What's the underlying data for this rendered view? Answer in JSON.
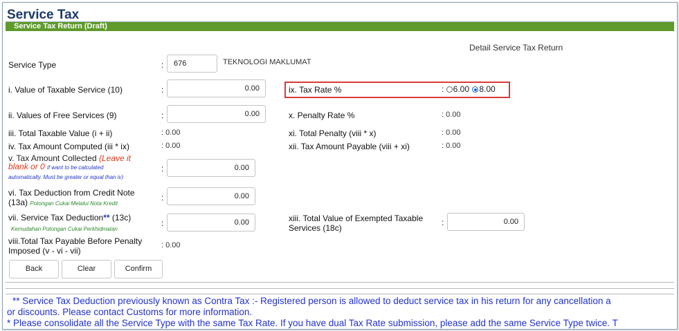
{
  "header": {
    "title": "Service Tax",
    "section": "Service Tax Return (Draft)",
    "detail_label": "Detail Service Tax Return"
  },
  "form": {
    "service_type": {
      "label": "Service Type",
      "code": "676",
      "name": "TEKNOLOGI MAKLUMAT"
    },
    "taxable_service": {
      "label": "i. Value of Taxable Service (10)",
      "value": "0.00"
    },
    "free_services": {
      "label": "ii. Values of Free Services (9)",
      "value": "0.00"
    },
    "total_taxable": {
      "label": "iii. Total Taxable Value (i + ii)",
      "value": ": 0.00"
    },
    "tax_computed": {
      "label": "iv. Tax Amount Computed (iii * ix)",
      "value": ": 0.00"
    },
    "tax_collected": {
      "label": "v. Tax Amount Collected",
      "hint_red_1": "(Leave it",
      "hint_red_2": "blank or 0",
      "hint_blue_1": "if want to be calculated",
      "hint_blue_2": "automatically. Must be greater or equal than iv)",
      "value": "0.00"
    },
    "credit_note": {
      "label_1": "vi. Tax Deduction from Credit Note",
      "label_2": "(13a)",
      "sub": "Potongan Cukai Melalui Nota Kredit",
      "value": "0.00"
    },
    "service_deduction": {
      "label": "vii. Service Tax Deduction",
      "stars": "**",
      "suffix": "(13c)",
      "sub": "Kemudahan Potongan Cukai Perkhidmatan",
      "value": "0.00"
    },
    "total_before_penalty": {
      "label_1": "viii.Total Tax Payable Before Penalty",
      "label_2": "Imposed (v - vi - vii)",
      "value": ": 0.00"
    },
    "tax_rate": {
      "label": "ix. Tax Rate %",
      "options": [
        "6.00",
        "8.00"
      ],
      "selected": "8.00"
    },
    "penalty_rate": {
      "label": "x. Penalty Rate %",
      "value": ": 0.00"
    },
    "total_penalty": {
      "label": "xi. Total Penalty (viii * x)",
      "value": ": 0.00"
    },
    "amount_payable": {
      "label": "xii. Tax Amount Payable (viii + xi)",
      "value": ": 0.00"
    },
    "exempted": {
      "label_1": "xiii. Total Value of Exempted Taxable",
      "label_2": "Services  (18c)",
      "value": "0.00"
    }
  },
  "buttons": {
    "back": "Back",
    "clear": "Clear",
    "confirm": "Confirm"
  },
  "notes": {
    "line1": "** Service Tax Deduction previously known as Contra Tax :- Registered person is allowed to deduct service tax in his return for any cancellation a",
    "line2": "or discounts. Please contact Customs for more information.",
    "line3": "* Please consolidate all the Service Type with the same Tax Rate. If you have dual Tax Rate submission, please add the same Service Type twice. T"
  },
  "colors": {
    "section_bar": "#5f9a2a",
    "title": "#1b3a6b",
    "highlight": "#d93a3a",
    "note_text": "#2332c9"
  }
}
